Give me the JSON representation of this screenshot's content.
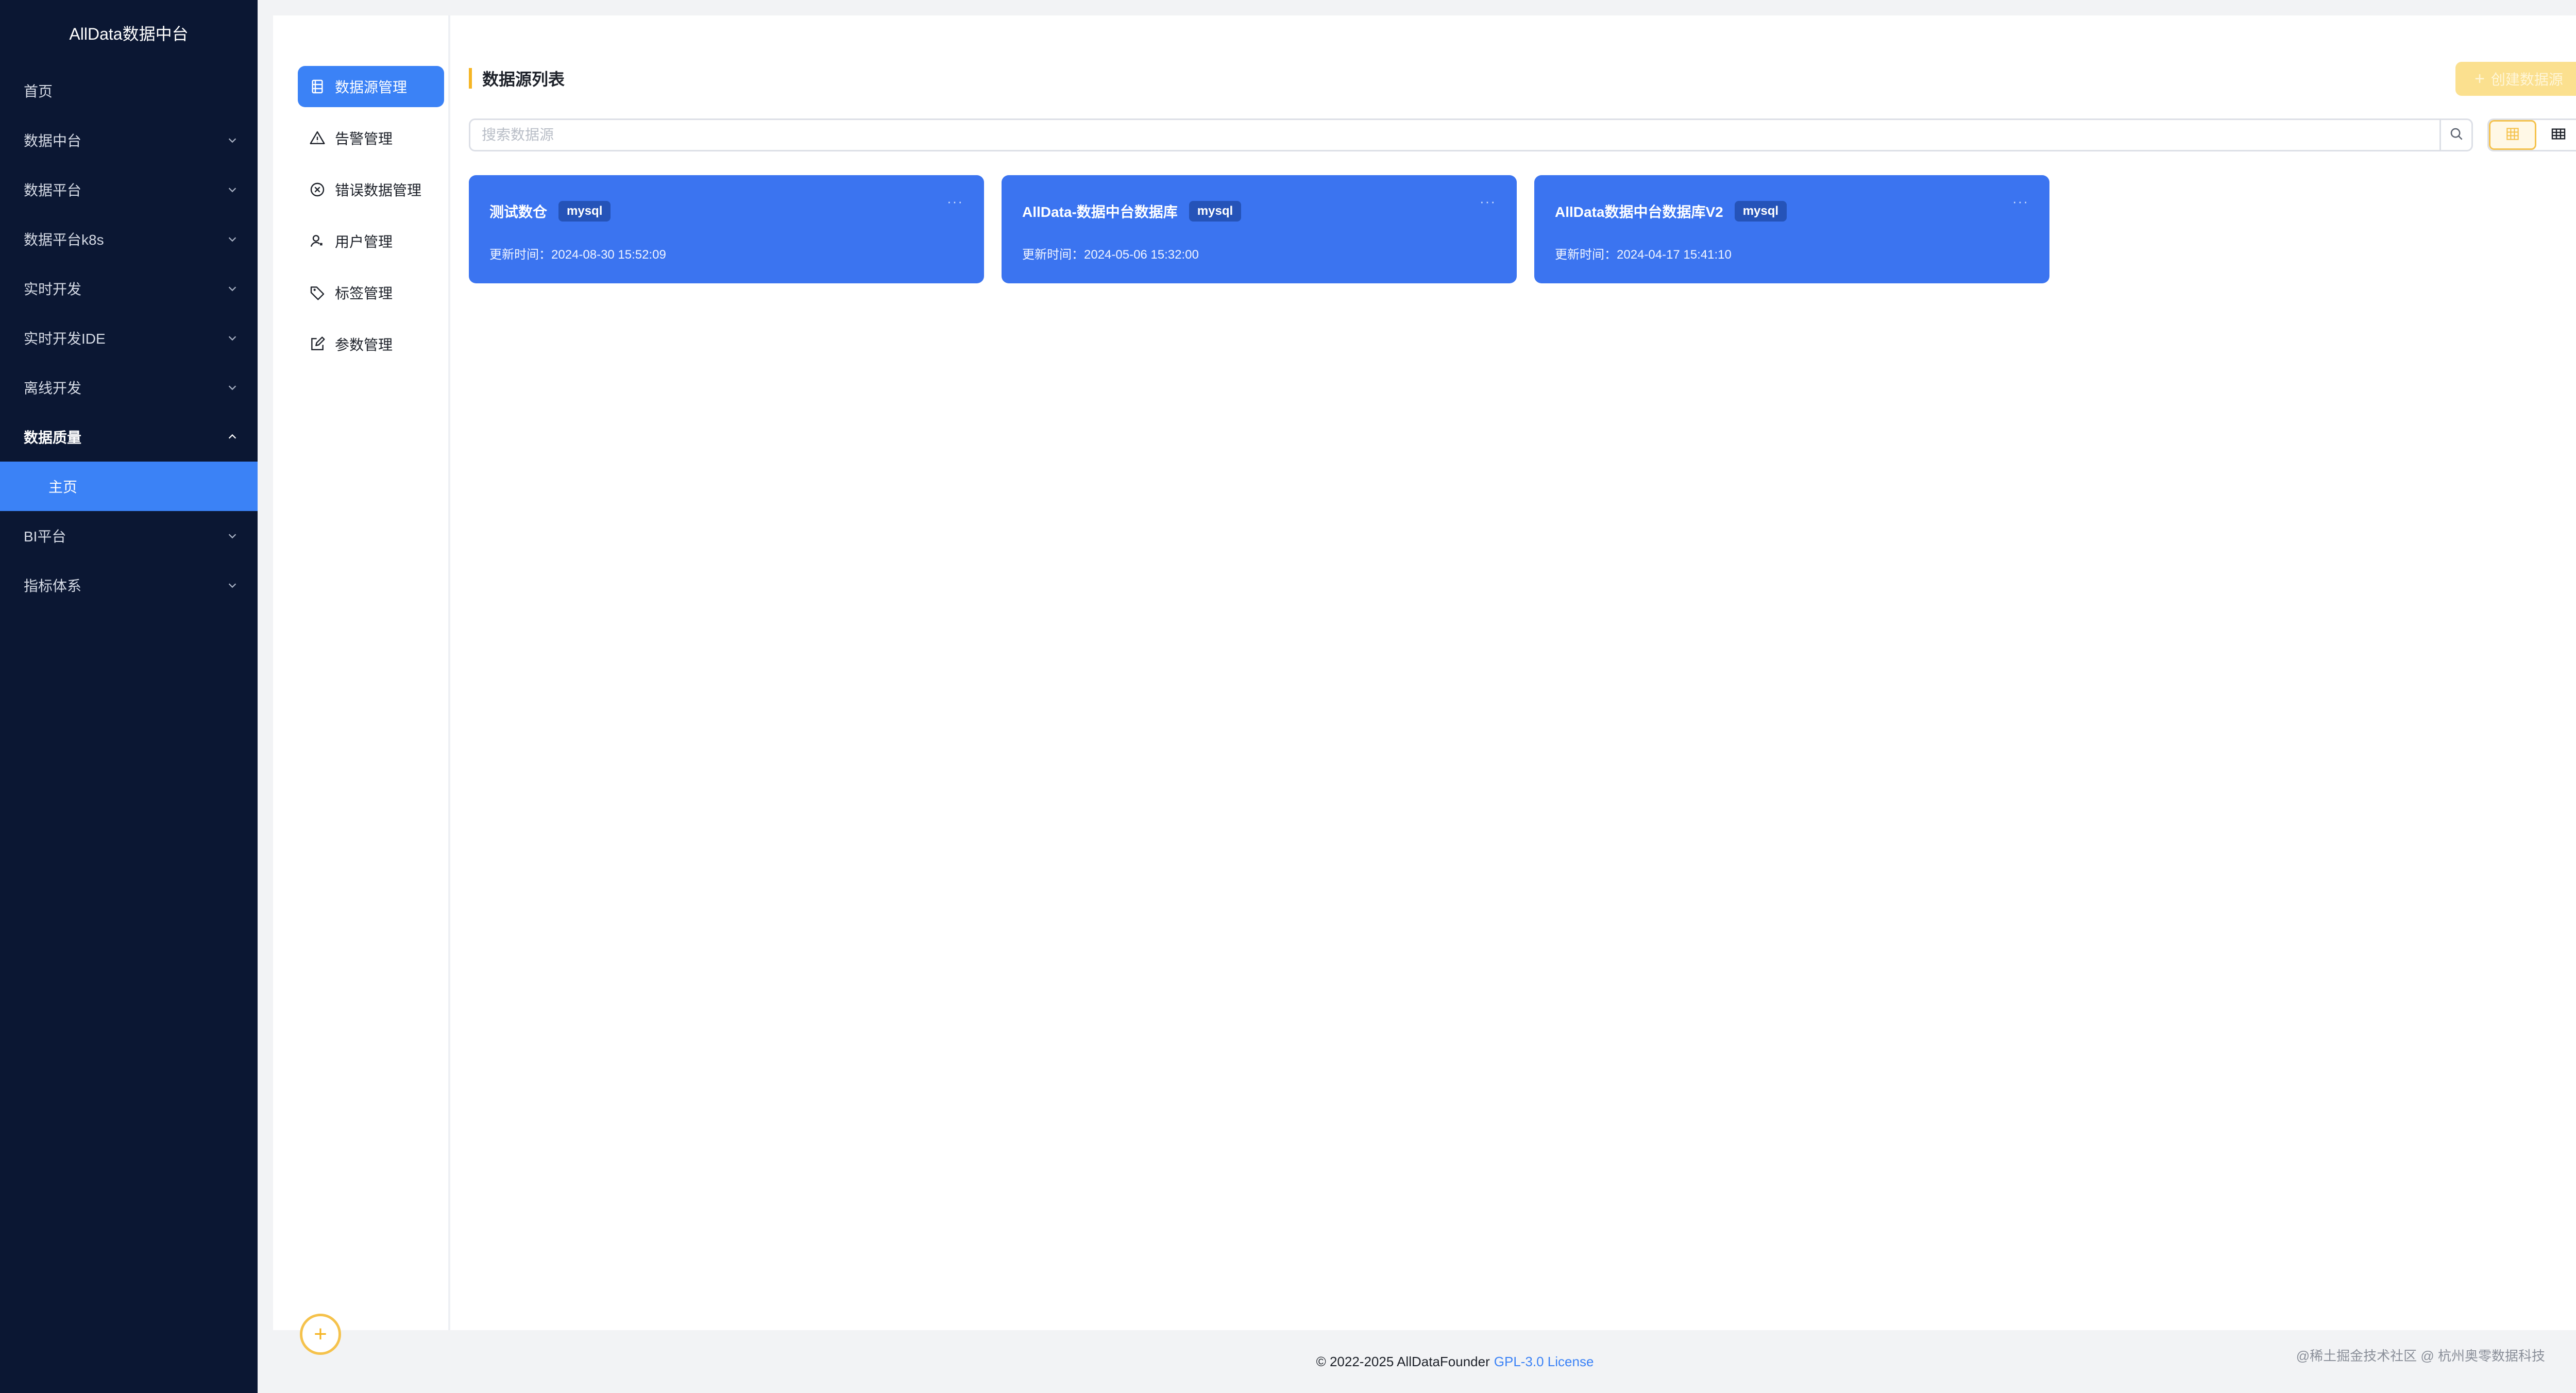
{
  "app": {
    "brand": "AllData数据中台"
  },
  "sidebar": {
    "items": [
      {
        "label": "首页",
        "chevron": ""
      },
      {
        "label": "数据中台",
        "chevron": "down"
      },
      {
        "label": "数据平台",
        "chevron": "down"
      },
      {
        "label": "数据平台k8s",
        "chevron": "down"
      },
      {
        "label": "实时开发",
        "chevron": "down"
      },
      {
        "label": "实时开发IDE",
        "chevron": "down"
      },
      {
        "label": "离线开发",
        "chevron": "down"
      },
      {
        "label": "数据质量",
        "chevron": "up",
        "expanded": true
      },
      {
        "label": "主页",
        "sub": true,
        "selected": true
      },
      {
        "label": "BI平台",
        "chevron": "down"
      },
      {
        "label": "指标体系",
        "chevron": "down"
      }
    ]
  },
  "subnav": {
    "items": [
      {
        "label": "数据源管理",
        "icon": "database-icon",
        "active": true
      },
      {
        "label": "告警管理",
        "icon": "warning-icon"
      },
      {
        "label": "错误数据管理",
        "icon": "error-circle-icon"
      },
      {
        "label": "用户管理",
        "icon": "user-icon"
      },
      {
        "label": "标签管理",
        "icon": "tag-icon"
      },
      {
        "label": "参数管理",
        "icon": "edit-icon"
      }
    ]
  },
  "main": {
    "title": "数据源列表",
    "create_button": "创建数据源",
    "search": {
      "placeholder": "搜索数据源",
      "value": ""
    },
    "cards": [
      {
        "name": "测试数仓",
        "type": "mysql",
        "updated_label": "更新时间：",
        "updated": "2024-08-30 15:52:09"
      },
      {
        "name": "AllData-数据中台数据库",
        "type": "mysql",
        "updated_label": "更新时间：",
        "updated": "2024-05-06 15:32:00"
      },
      {
        "name": "AllData数据中台数据库V2",
        "type": "mysql",
        "updated_label": "更新时间：",
        "updated": "2024-04-17 15:41:10"
      }
    ]
  },
  "footer": {
    "copyright": "© 2022-2025 AllDataFounder",
    "license": "GPL-3.0 License",
    "watermark": "@稀土掘金技术社区 @ 杭州奥零数据科技"
  },
  "colors": {
    "sidebar_bg": "#0b1733",
    "accent": "#3b82f6",
    "card_bg": "#3b74f0",
    "warning_yellow": "#f5b524"
  }
}
